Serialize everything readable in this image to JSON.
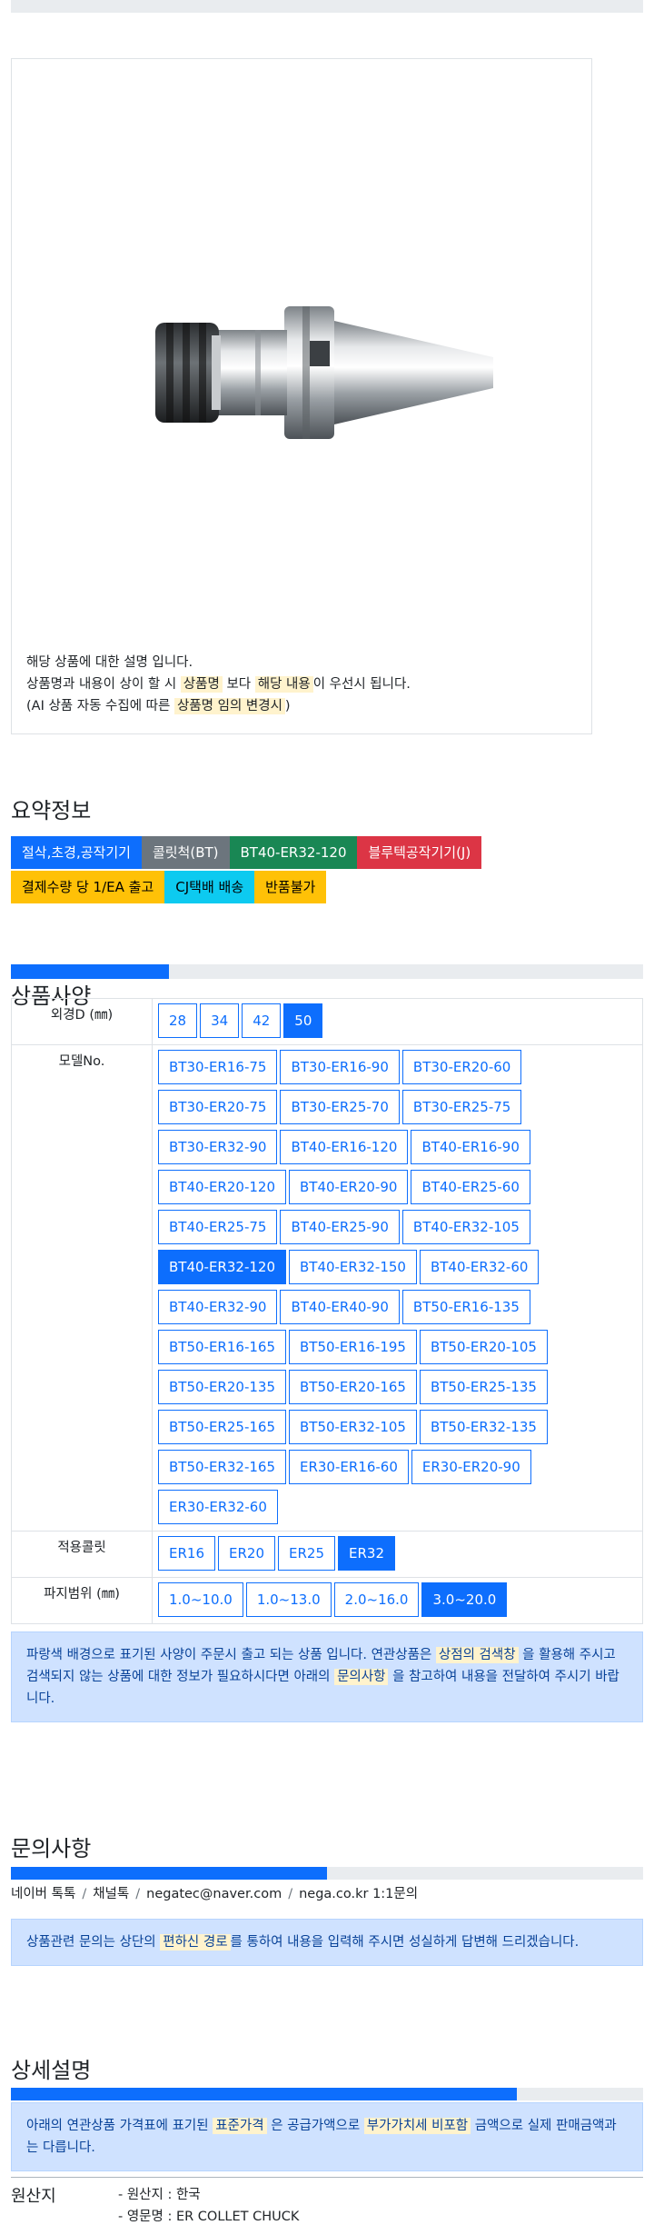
{
  "notice": {
    "line1": "해당 상품에 대한 설명 입니다.",
    "line2_pre": "상품명과 내용이 상이 할 시",
    "line2_hl1": "상품명",
    "line2_mid": "보다",
    "line2_hl2": "해당 내용",
    "line2_post": "이 우선시 됩니다.",
    "line3_pre": "(AI 상품 자동 수집에 따른",
    "line3_hl": "상품명 임의 변경시",
    "line3_post": ")"
  },
  "summary": {
    "title": "요약정보",
    "chips_row1": [
      {
        "label": "절삭,초경,공작기기",
        "color": "#0d6efd"
      },
      {
        "label": "콜릿척(BT)",
        "color": "#6c757d"
      },
      {
        "label": "BT40-ER32-120",
        "color": "#198754"
      },
      {
        "label": "블루텍공작기기(J)",
        "color": "#dc3545"
      }
    ],
    "chips_row2": [
      {
        "label": "결제수량 당 1/EA 출고",
        "color": "#ffc107"
      },
      {
        "label": "CJ택배 배송",
        "color": "#0dcaf0"
      },
      {
        "label": "반품불가",
        "color": "#ffc107"
      }
    ]
  },
  "spec": {
    "title": "상품사양",
    "progress": 0.25,
    "rows": [
      {
        "label": "외경D (㎜)",
        "options": [
          "28",
          "34",
          "42",
          "50"
        ],
        "selected": "50"
      },
      {
        "label": "모델No.",
        "options": [
          "BT30-ER16-75",
          "BT30-ER16-90",
          "BT30-ER20-60",
          "BT30-ER20-75",
          "BT30-ER25-70",
          "BT30-ER25-75",
          "BT30-ER32-90",
          "BT40-ER16-120",
          "BT40-ER16-90",
          "BT40-ER20-120",
          "BT40-ER20-90",
          "BT40-ER25-60",
          "BT40-ER25-75",
          "BT40-ER25-90",
          "BT40-ER32-105",
          "BT40-ER32-120",
          "BT40-ER32-150",
          "BT40-ER32-60",
          "BT40-ER32-90",
          "BT40-ER40-90",
          "BT50-ER16-135",
          "BT50-ER16-165",
          "BT50-ER16-195",
          "BT50-ER20-105",
          "BT50-ER20-135",
          "BT50-ER20-165",
          "BT50-ER25-135",
          "BT50-ER25-165",
          "BT50-ER32-105",
          "BT50-ER32-135",
          "BT50-ER32-165",
          "ER30-ER16-60",
          "ER30-ER20-90",
          "ER30-ER32-60"
        ],
        "selected": "BT40-ER32-120"
      },
      {
        "label": "적용콜릿",
        "options": [
          "ER16",
          "ER20",
          "ER25",
          "ER32"
        ],
        "selected": "ER32"
      },
      {
        "label": "파지범위 (㎜)",
        "options": [
          "1.0~10.0",
          "1.0~13.0",
          "2.0~16.0",
          "3.0~20.0"
        ],
        "selected": "3.0~20.0"
      }
    ],
    "alert_pre": "파랑색 배경으로 표기된 사양이 주문시 출고 되는 상품 입니다. 연관상품은",
    "alert_hl1": "상점의 검색창",
    "alert_mid": "을 활용해 주시고 검색되지 않는 상품에 대한 정보가 필요하시다면 아래의",
    "alert_hl2": "문의사항",
    "alert_post": "을 참고하여 내용을 전달하여 주시기 바랍니다."
  },
  "inquiry": {
    "title": "문의사항",
    "progress": 0.5,
    "contacts": [
      "네이버 톡톡",
      "채널톡",
      "negatec@naver.com",
      "nega.co.kr 1:1문의"
    ],
    "separator": "/",
    "alert_pre": "상품관련 문의는 상단의",
    "alert_hl": "편하신 경로",
    "alert_post": "를 통하여 내용을 입력해 주시면 성실하게 답변해 드리겠습니다."
  },
  "detail": {
    "title": "상세설명",
    "progress": 0.8,
    "alert_pre": "아래의 연관상품 가격표에 표기된",
    "alert_hl1": "표준가격",
    "alert_mid": "은 공급가액으로",
    "alert_hl2": "부가가치세 비포함",
    "alert_post": "금액으로 실제 판매금액과는 다릅니다."
  },
  "origin": {
    "label": "원산지",
    "items": [
      "- 원산지 : 한국",
      "- 영문명 : ER COLLET CHUCK"
    ]
  }
}
